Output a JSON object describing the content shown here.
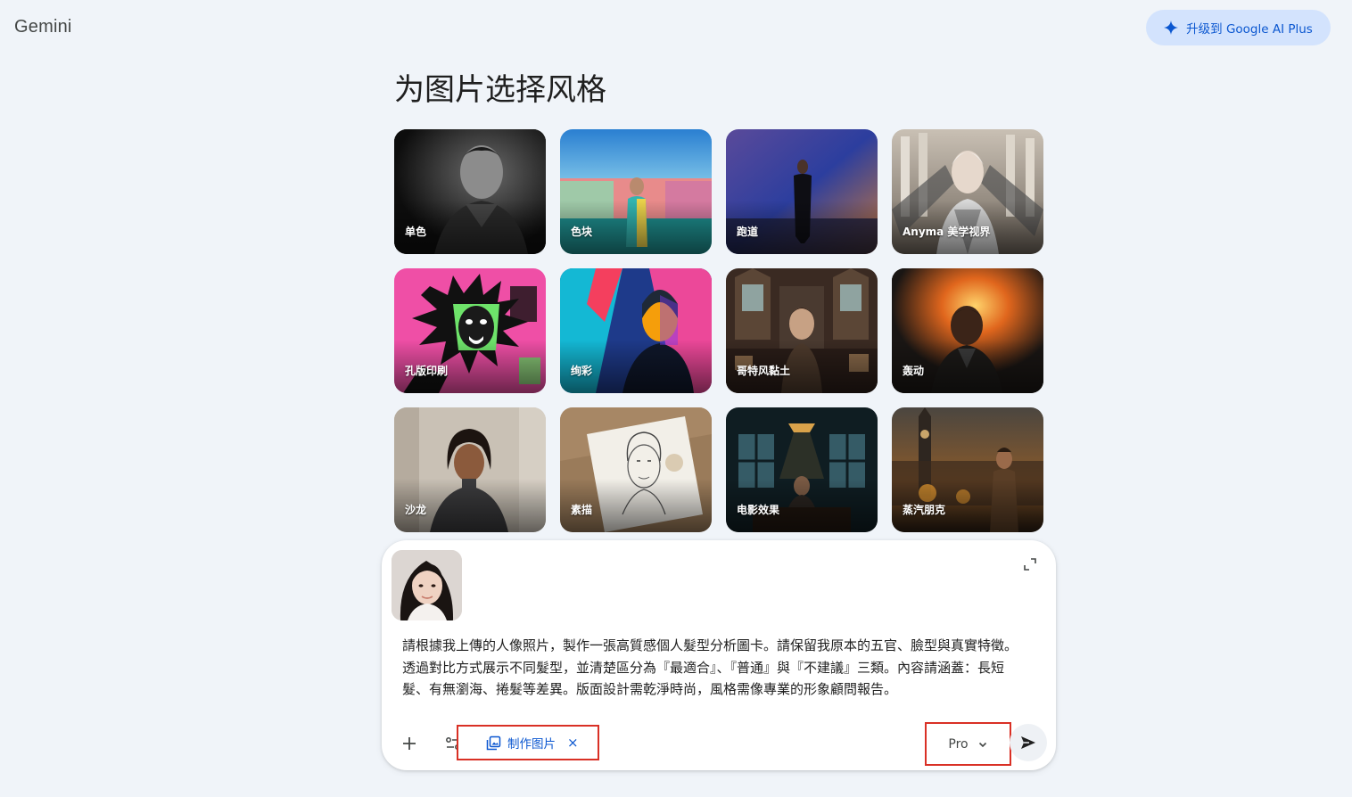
{
  "app": {
    "brand": "Gemini"
  },
  "header": {
    "upgrade_label": "升级到 Google AI Plus",
    "upgrade_icon": "sparkle-icon"
  },
  "main": {
    "title": "为图片选择风格",
    "styles": [
      {
        "label": "单色"
      },
      {
        "label": "色块"
      },
      {
        "label": "跑道"
      },
      {
        "label": "Anyma 美学视界"
      },
      {
        "label": "孔版印刷"
      },
      {
        "label": "绚彩"
      },
      {
        "label": "哥特风黏土"
      },
      {
        "label": "轰动"
      },
      {
        "label": "沙龙"
      },
      {
        "label": "素描"
      },
      {
        "label": "电影效果"
      },
      {
        "label": "蒸汽朋克"
      }
    ]
  },
  "composer": {
    "attachment_icon": "portrait-photo-thumbnail",
    "prompt": "請根據我上傳的人像照片，製作一張高質感個人髮型分析圖卡。請保留我原本的五官、臉型與真實特徵。透過對比方式展示不同髮型，並清楚區分為『最適合』、『普通』與『不建議』三類。內容請涵蓋：長短髮、有無瀏海、捲髮等差異。版面設計需乾淨時尚，風格需像專業的形象顧問報告。",
    "tool_chip": {
      "label": "制作图片",
      "icon": "image-gallery-icon",
      "close": "×"
    },
    "model": {
      "label": "Pro",
      "icon": "chevron-down-icon"
    },
    "icons": [
      "plus-icon",
      "tools-icon",
      "expand-icon",
      "send-icon"
    ],
    "colors": {
      "accent": "#0b57d0",
      "highlight_border": "#d93025"
    }
  }
}
